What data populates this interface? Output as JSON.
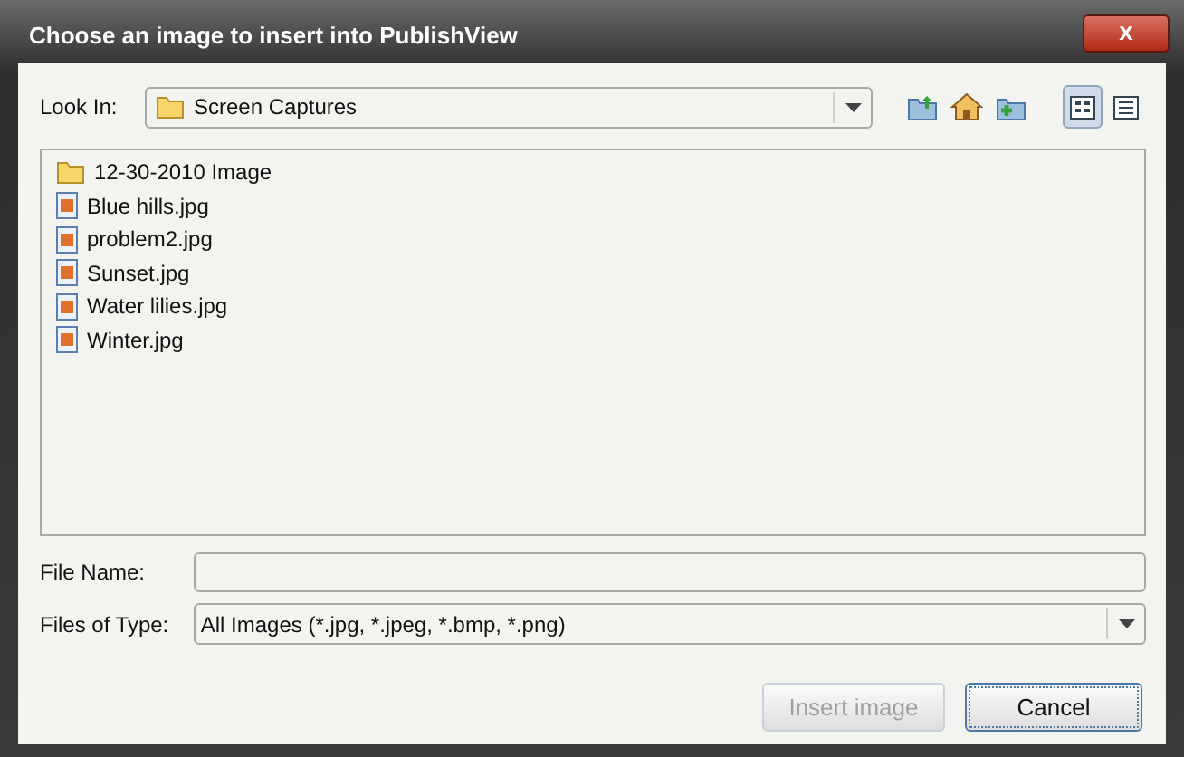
{
  "window": {
    "title": "Choose an image to insert into PublishView",
    "close": "x"
  },
  "look_in": {
    "label": "Look In:",
    "value": "Screen Captures"
  },
  "files": [
    {
      "name": "12-30-2010 Image",
      "kind": "folder"
    },
    {
      "name": "Blue hills.jpg",
      "kind": "image"
    },
    {
      "name": "problem2.jpg",
      "kind": "image"
    },
    {
      "name": "Sunset.jpg",
      "kind": "image"
    },
    {
      "name": "Water lilies.jpg",
      "kind": "image"
    },
    {
      "name": "Winter.jpg",
      "kind": "image"
    }
  ],
  "view_modes": [
    {
      "kind": "list",
      "selected": true
    },
    {
      "kind": "details",
      "selected": false
    }
  ],
  "file_name": {
    "label": "File Name:"
  },
  "file_type": {
    "label": "Files of Type:",
    "value": "All Images (*.jpg, *.jpeg, *.bmp, *.png)"
  },
  "buttons": [
    {
      "label": "Insert image",
      "disabled": true,
      "focused": false
    },
    {
      "label": "Cancel",
      "disabled": false,
      "focused": true
    }
  ]
}
